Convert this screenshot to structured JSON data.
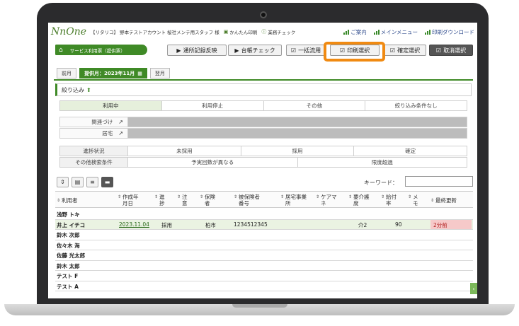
{
  "app": {
    "logo_text": "NnOne",
    "agency": "【リタリコ】 野本テストアカウント 桜社メンテ用スタッフ 様",
    "links": [
      {
        "icon": "printer-icon",
        "label": "かんたん印刷"
      },
      {
        "icon": "info-icon",
        "label": "業務チェック"
      }
    ],
    "menu": [
      {
        "icon": "bar-chart-icon",
        "label": "ご案内"
      },
      {
        "icon": "bar-chart-icon",
        "label": "メインメニュー"
      },
      {
        "icon": "bar-chart-icon",
        "label": "印刷ダウンロード"
      }
    ]
  },
  "toolbar": {
    "page_label": "サービス利用票（提供票）",
    "buttons": [
      {
        "icon": "play-icon",
        "label": "通所記録反映"
      },
      {
        "icon": "play-icon",
        "label": "台帳チェック"
      },
      {
        "icon": "checkbox-icon",
        "label": "一括流用"
      },
      {
        "icon": "checkbox-icon",
        "label": "印刷選択"
      },
      {
        "icon": "checkbox-icon",
        "label": "確定選択"
      },
      {
        "icon": "checkbox-icon",
        "label": "取消選択"
      }
    ],
    "highlighted": "印刷選択",
    "highlight_color": "#f08a12"
  },
  "month_tabs": {
    "prev": "前月",
    "current": "提供月：2023年11月",
    "next": "翌月"
  },
  "filter": {
    "title": "絞り込み",
    "status_options": [
      "利用中",
      "利用停止",
      "その他",
      "絞り込み条件なし"
    ],
    "status_selected": "利用中",
    "related_label": "関連づけ",
    "home_label": "居宅",
    "progress_label": "進捗状況",
    "progress_options": [
      "未採用",
      "採用",
      "確定"
    ],
    "other_label": "その他検索条件",
    "other_options": [
      "予実回数が異なる",
      "限度超過"
    ]
  },
  "search": {
    "keyword_label": "キーワード：",
    "keyword_value": ""
  },
  "table": {
    "columns": [
      "利用者",
      "作成年月日",
      "進捗",
      "注意",
      "保険者",
      "被保険者番号",
      "居宅事業所",
      "ケアマネ",
      "要介護度",
      "給付率",
      "メモ",
      "最終更新"
    ],
    "rows": [
      {
        "name": "浅野 トキ",
        "date": "",
        "progress": "",
        "insurer": "",
        "number": "",
        "care": "",
        "rate": "",
        "updated": ""
      },
      {
        "name": "井上 イチコ",
        "date": "2023.11.04",
        "progress": "採用",
        "insurer": "柏市",
        "number": "1234512345",
        "care": "介2",
        "rate": "90",
        "updated": "2分前"
      },
      {
        "name": "鈴木 次郎",
        "date": "",
        "progress": "",
        "insurer": "",
        "number": "",
        "care": "",
        "rate": "",
        "updated": ""
      },
      {
        "name": "佐々木 海",
        "date": "",
        "progress": "",
        "insurer": "",
        "number": "",
        "care": "",
        "rate": "",
        "updated": ""
      },
      {
        "name": "佐藤 光太郎",
        "date": "",
        "progress": "",
        "insurer": "",
        "number": "",
        "care": "",
        "rate": "",
        "updated": ""
      },
      {
        "name": "鈴木 太郎",
        "date": "",
        "progress": "",
        "insurer": "",
        "number": "",
        "care": "",
        "rate": "",
        "updated": ""
      },
      {
        "name": "テスト F",
        "date": "",
        "progress": "",
        "insurer": "",
        "number": "",
        "care": "",
        "rate": "",
        "updated": ""
      },
      {
        "name": "テスト A",
        "date": "",
        "progress": "",
        "insurer": "",
        "number": "",
        "care": "",
        "rate": "",
        "updated": ""
      }
    ]
  },
  "colors": {
    "brand_green": "#3f8a26",
    "link_blue": "#2e4a8c",
    "updated_bg": "#f6c9c9"
  }
}
